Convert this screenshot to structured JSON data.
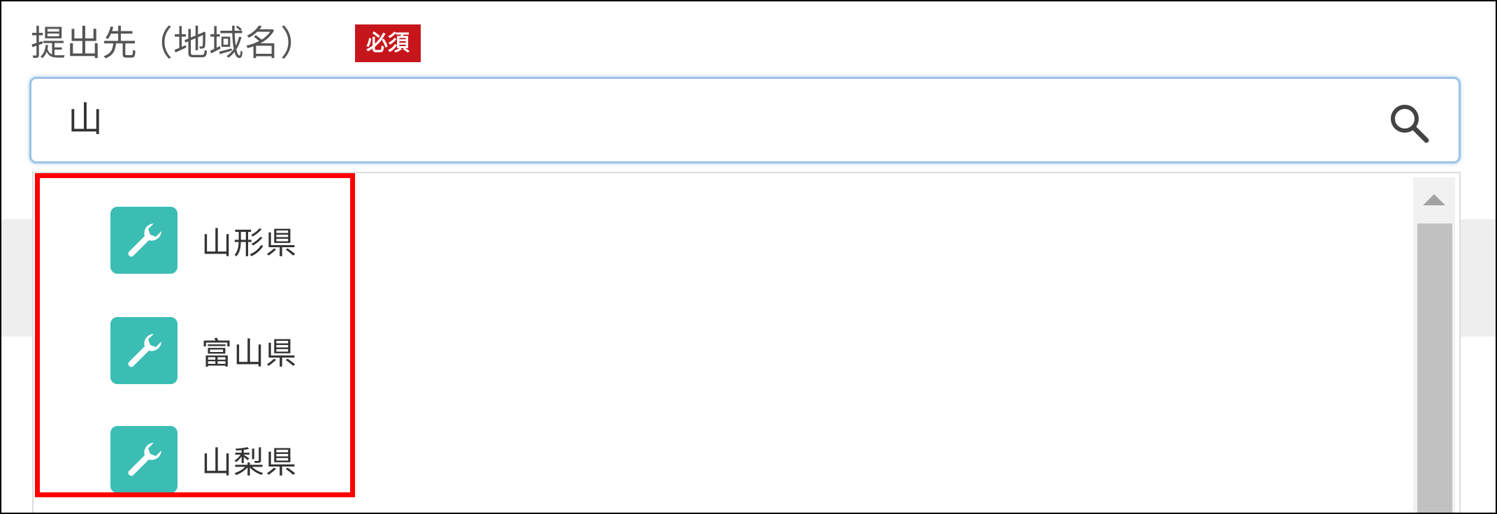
{
  "field": {
    "label": "提出先（地域名）",
    "required_badge": "必須"
  },
  "search": {
    "value": "山",
    "icon": "search-icon"
  },
  "dropdown": {
    "items": [
      {
        "label": "山形県",
        "icon": "wrench-icon"
      },
      {
        "label": "富山県",
        "icon": "wrench-icon"
      },
      {
        "label": "山梨県",
        "icon": "wrench-icon"
      }
    ]
  },
  "colors": {
    "required_badge": "#c6161c",
    "item_icon_bg": "#3bbdb4",
    "focus_border": "#9cc3e8",
    "highlight": "#ff0000"
  }
}
